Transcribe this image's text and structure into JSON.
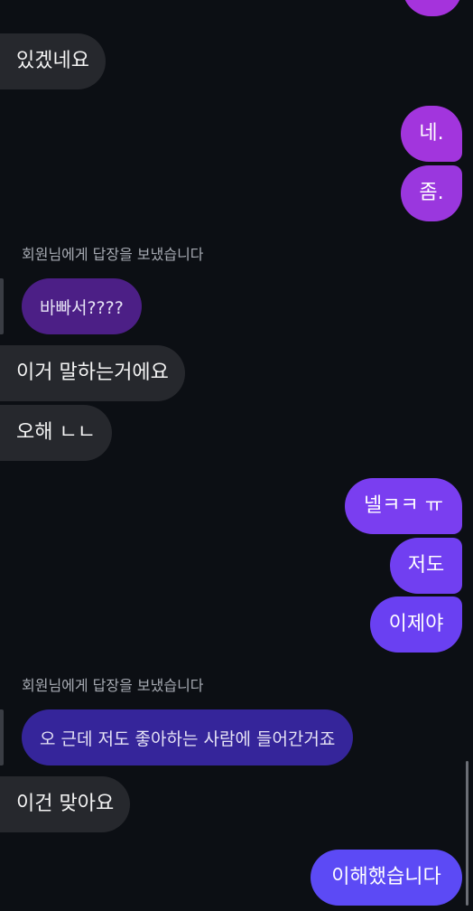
{
  "messages": {
    "m1": "있겠네요",
    "m2": "네.",
    "m3": "좀.",
    "reply1_label": "회원님에게 답장을 보냈습니다",
    "reply1_quote": "바빠서????",
    "m4": "이거 말하는거에요",
    "m5": "오해 ㄴㄴ",
    "m6": "넬ㅋㅋ ㅠ",
    "m7": "저도",
    "m8": "이제야",
    "reply2_label": "회원님에게 답장을 보냈습니다",
    "reply2_quote": "오 근데 저도 좋아하는 사람에 들어간거죠",
    "m9": "이건 맞아요",
    "m10": "이해했습니다"
  },
  "colors": {
    "background": "#0c0f14",
    "incoming_bubble": "#26282d",
    "outgoing_purple": "#9b35de",
    "outgoing_indigo": "#6a40f2",
    "quoted_bubble": "#4a2388"
  }
}
